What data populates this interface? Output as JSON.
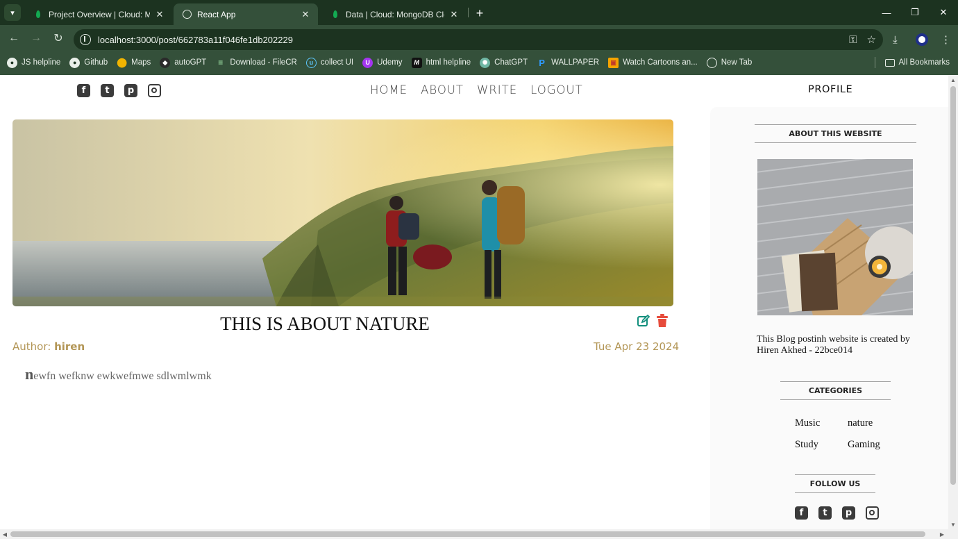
{
  "browser": {
    "tabs": [
      {
        "title": "Project Overview | Cloud: Mon",
        "active": false,
        "favicon": "mongodb-leaf-icon"
      },
      {
        "title": "React App",
        "active": true,
        "favicon": "globe-icon"
      },
      {
        "title": "Data | Cloud: MongoDB Cloud",
        "active": false,
        "favicon": "mongodb-leaf-icon"
      }
    ],
    "url": "localhost:3000/post/662783a11f046fe1db202229",
    "bookmarks": [
      {
        "label": "JS helpline",
        "icon": "github-icon"
      },
      {
        "label": "Github",
        "icon": "github-icon"
      },
      {
        "label": "Maps",
        "icon": "maps-pin-icon"
      },
      {
        "label": "autoGPT",
        "icon": "autogpt-icon"
      },
      {
        "label": "Download - FileCR",
        "icon": "filecr-icon"
      },
      {
        "label": "collect UI",
        "icon": "collectui-icon"
      },
      {
        "label": "Udemy",
        "icon": "udemy-icon"
      },
      {
        "label": "html helpline",
        "icon": "m-logo-icon"
      },
      {
        "label": "ChatGPT",
        "icon": "chatgpt-icon"
      },
      {
        "label": "WALLPAPER",
        "icon": "wallpaper-icon"
      },
      {
        "label": "Watch Cartoons an...",
        "icon": "cartoons-icon"
      },
      {
        "label": "New Tab",
        "icon": "globe-icon"
      }
    ],
    "all_bookmarks": "All Bookmarks"
  },
  "nav": {
    "menu": [
      "HOME",
      "ABOUT",
      "WRITE",
      "LOGOUT"
    ],
    "profile": "PROFILE",
    "social_icons": [
      "facebook-square-icon",
      "twitter-square-icon",
      "pinterest-square-icon",
      "instagram-icon"
    ]
  },
  "post": {
    "title": "THIS IS ABOUT NATURE",
    "author_label": "Author:",
    "author": "hiren",
    "date": "Tue Apr 23 2024",
    "desc_first_letter": "n",
    "desc_rest": "ewfn wefknw ewkwefmwe sdlwmlwmk",
    "action_icons": [
      "edit-icon",
      "trash-icon"
    ]
  },
  "sidebar": {
    "about_title": "ABOUT THIS WEBSITE",
    "about_text": "This Blog postinh website is created by Hiren Akhed - 22bce014",
    "categories_title": "CATEGORIES",
    "categories": [
      "Music",
      "nature",
      "Study",
      "Gaming"
    ],
    "follow_title": "FOLLOW US"
  },
  "colors": {
    "chrome_dark": "#1c3320",
    "chrome_light": "#34503a",
    "meta_gold": "#b39656",
    "edit_teal": "#138f7d",
    "delete_red": "#e74c3c"
  }
}
